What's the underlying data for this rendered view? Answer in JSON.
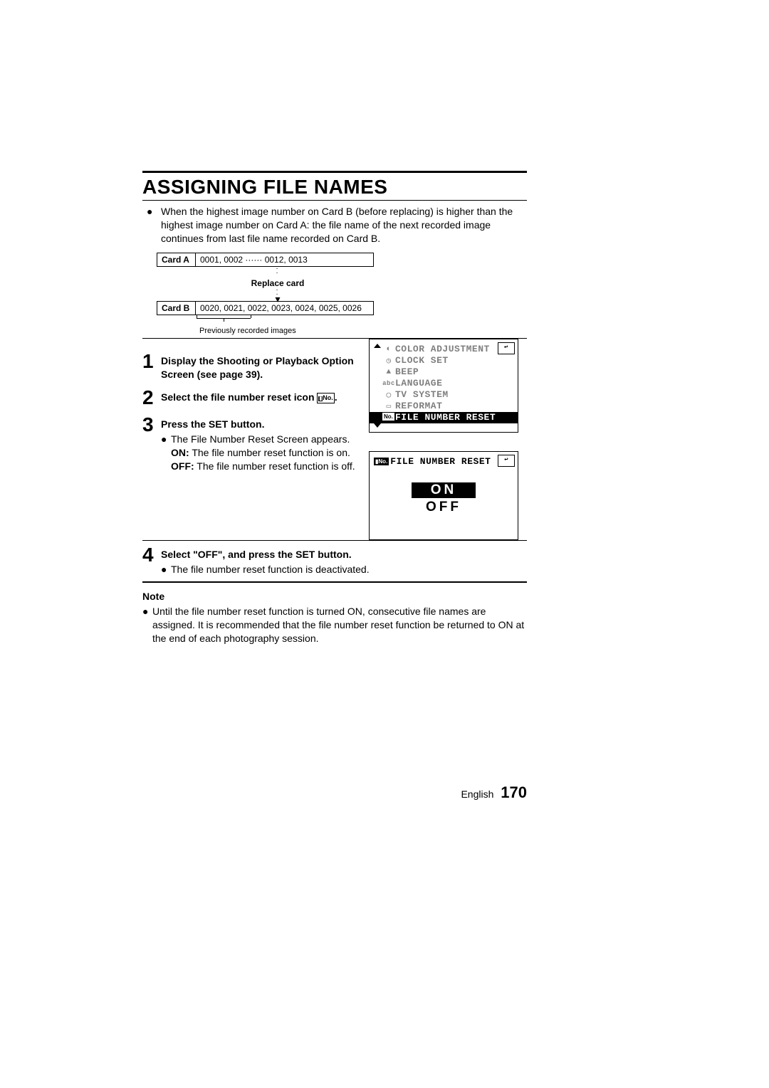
{
  "title": "ASSIGNING FILE NAMES",
  "intro": "When the highest image number on Card B (before replacing) is higher than the highest image number on Card A: the file name of the next recorded image continues from last file name recorded on Card B.",
  "card_a_label": "Card A",
  "card_a_values": "0001, 0002 ······ 0012, 0013",
  "replace_label": "Replace card",
  "card_b_label": "Card B",
  "card_b_values": "0020, 0021, 0022, 0023, 0024, 0025, 0026",
  "prev_recorded": "Previously recorded images",
  "steps": {
    "s1": "Display the Shooting or Playback Option Screen (see page 39).",
    "s2a": "Select the file number reset icon",
    "s2b": ".",
    "s3_title": "Press the SET button.",
    "s3_bullet": "The File Number Reset Screen appears.",
    "s3_on_lbl": "ON:",
    "s3_on_txt": "The file number reset function is on.",
    "s3_off_lbl": "OFF:",
    "s3_off_txt": "The file number reset function is off.",
    "s4_title": "Select \"OFF\", and press the SET button.",
    "s4_bullet": "The file number reset function is deactivated."
  },
  "menu": {
    "items": {
      "i0": "COLOR ADJUSTMENT",
      "i1": "CLOCK SET",
      "i2": "BEEP",
      "i3": "LANGUAGE",
      "i4": "TV SYSTEM",
      "i5": "REFORMAT",
      "i6": "FILE NUMBER RESET"
    }
  },
  "screen2": {
    "header": "FILE NUMBER RESET",
    "on": "ON",
    "off": "OFF"
  },
  "note_hdr": "Note",
  "note_txt": "Until the file number reset function is turned ON, consecutive file names are assigned. It is recommended that the file number reset function be returned to ON at the end of each photography session.",
  "footer_lang": "English",
  "footer_page": "170"
}
